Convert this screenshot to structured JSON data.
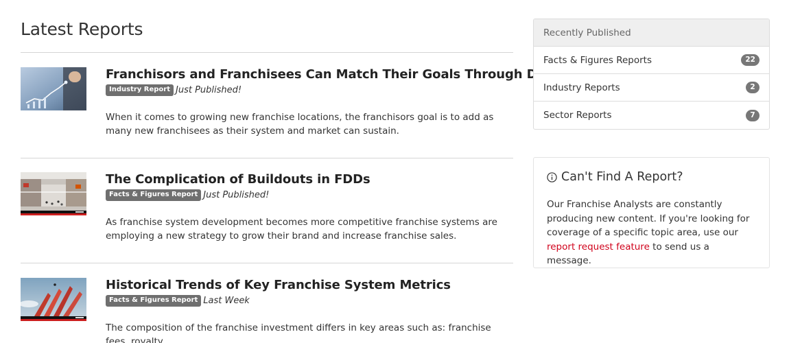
{
  "main": {
    "title": "Latest Reports",
    "reports": [
      {
        "title": "Franchisors and Franchisees Can Match Their Goals Through Data",
        "badge": "Industry Report",
        "when": "Just Published!",
        "excerpt": "When it comes to growing new franchise locations, the franchisors goal is to add as many new franchisees as their system and market can sustain.",
        "thumb_icon": "business-chart-photo"
      },
      {
        "title": "The Complication of Buildouts in FDDs",
        "badge": "Facts & Figures Report",
        "when": "Just Published!",
        "excerpt": "As franchise system development becomes more competitive franchise systems are employing a new strategy to grow their brand and increase franchise sales.",
        "thumb_icon": "shopping-mall-photo"
      },
      {
        "title": "Historical Trends of Key Franchise System Metrics",
        "badge": "Facts & Figures Report",
        "when": "Last Week",
        "excerpt": "The composition of the franchise investment differs in key areas such as: franchise fees, royalty",
        "thumb_icon": "arrows-growth-photo"
      }
    ]
  },
  "sidebar": {
    "recent": {
      "heading": "Recently Published",
      "items": [
        {
          "label": "Facts & Figures Reports",
          "count": "22"
        },
        {
          "label": "Industry Reports",
          "count": "2"
        },
        {
          "label": "Sector Reports",
          "count": "7"
        }
      ]
    },
    "cant_find": {
      "title": "Can't Find A Report?",
      "body_before": "Our Franchise Analysts are constantly producing new content. If you're looking for coverage of a specific topic area, use our ",
      "link": "report request feature",
      "body_after": " to send us a message."
    }
  },
  "colors": {
    "link": "#d0021b",
    "badge": "#6f6f6f",
    "count_pill": "#777777",
    "panel_heading_bg": "#efefef"
  }
}
